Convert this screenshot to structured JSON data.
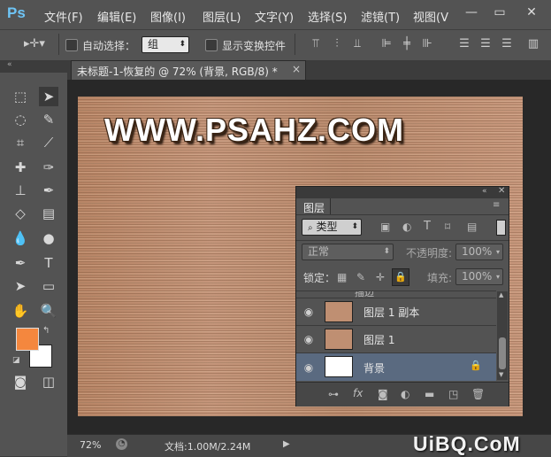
{
  "app": {
    "logo": "Ps"
  },
  "menu": [
    "文件(F)",
    "编辑(E)",
    "图像(I)",
    "图层(L)",
    "文字(Y)",
    "选择(S)",
    "滤镜(T)",
    "视图(V"
  ],
  "window_controls": {
    "minimize": "—",
    "maximize": "▭",
    "close": "✕"
  },
  "options": {
    "auto_select_label": "自动选择：",
    "auto_select_value": "组",
    "show_transform_label": "显示变换控件"
  },
  "document": {
    "tab_title": "未标题-1-恢复的 @ 72% (背景, RGB/8) *",
    "tab_close": "×",
    "canvas_text": "WWW.PSAHZ.COM",
    "zoom": "72%",
    "doc_info": "文档:1.00M/2.24M"
  },
  "layers_panel": {
    "title": "图层",
    "filter_kind": "类型",
    "blend_mode": "正常",
    "opacity_label": "不透明度:",
    "opacity_value": "100%",
    "lock_label": "锁定：",
    "fill_label": "填充:",
    "fill_value": "100%",
    "partial_row": "描边",
    "layers": [
      {
        "name": "图层 1 副本",
        "selected": false
      },
      {
        "name": "图层 1",
        "selected": false
      },
      {
        "name": "背景",
        "selected": true
      }
    ]
  },
  "colors": {
    "foreground": "#f4873e",
    "background": "#ffffff",
    "selected_row": "#5a6a80",
    "accent": "#6ec4f5"
  },
  "site_watermark": "UiBQ.CoM"
}
